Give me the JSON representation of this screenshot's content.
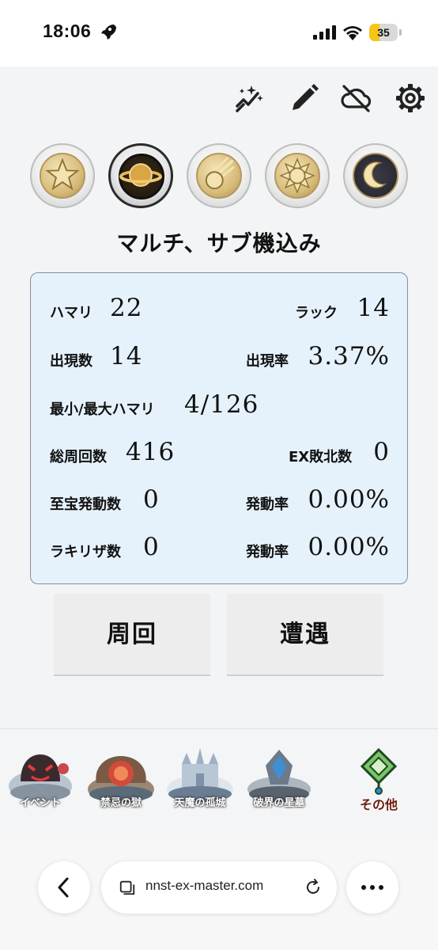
{
  "status": {
    "time": "18:06",
    "battery": "35",
    "battery_level": 0.35
  },
  "toolbar": {
    "icons": [
      "sparkle-chart-icon",
      "pencil-icon",
      "cloud-off-icon",
      "gear-icon"
    ]
  },
  "elements": [
    {
      "name": "star-element",
      "selected": false
    },
    {
      "name": "ring-planet-element",
      "selected": true
    },
    {
      "name": "meteor-element",
      "selected": false
    },
    {
      "name": "sun-element",
      "selected": false
    },
    {
      "name": "moon-element",
      "selected": false
    }
  ],
  "mode_title": "マルチ、サブ機込み",
  "stats": {
    "hamari": {
      "label": "ハマリ",
      "value": "22"
    },
    "luck": {
      "label": "ラック",
      "value": "14"
    },
    "appear_count": {
      "label": "出現数",
      "value": "14"
    },
    "appear_rate": {
      "label": "出現率",
      "value": "3.37%"
    },
    "min_max": {
      "label": "最小/最大ハマリ",
      "value": "4/126"
    },
    "total_laps": {
      "label": "総周回数",
      "value": "416"
    },
    "ex_defeat": {
      "label": "EX敗北数",
      "value": "0"
    },
    "treasure": {
      "label": "至宝発動数",
      "value": "0"
    },
    "treasure_rate": {
      "label": "発動率",
      "value": "0.00%"
    },
    "lucky_sa": {
      "label": "ラキリザ数",
      "value": "0"
    },
    "lucky_sa_rate": {
      "label": "発動率",
      "value": "0.00%"
    }
  },
  "actions": {
    "laps": "周回",
    "encounter": "遭遇"
  },
  "bottom_nav": [
    {
      "label": "イベント",
      "icon": "event-icon"
    },
    {
      "label": "禁忌の獄",
      "icon": "forbidden-prison-icon"
    },
    {
      "label": "天魔の孤城",
      "icon": "tenma-castle-icon"
    },
    {
      "label": "破界の星墓",
      "icon": "hakai-grave-icon"
    },
    {
      "label": "その他",
      "icon": "other-icon"
    }
  ],
  "browser": {
    "url": "nnst-ex-master.com"
  }
}
